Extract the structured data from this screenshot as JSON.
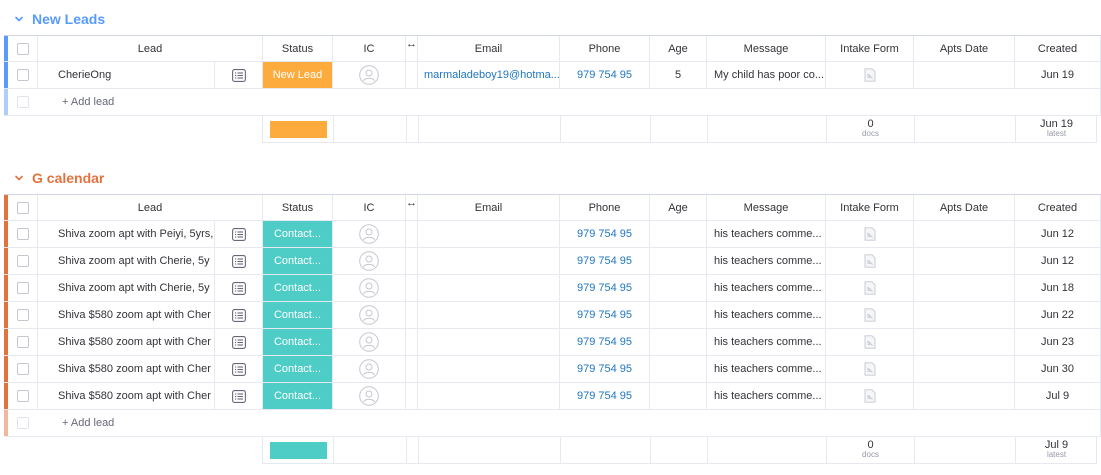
{
  "columns": {
    "lead": "Lead",
    "status": "Status",
    "ic": "IC",
    "resize": "↔",
    "email": "Email",
    "phone": "Phone",
    "age": "Age",
    "message": "Message",
    "intake_form": "Intake Form",
    "apts_date": "Apts Date",
    "created": "Created"
  },
  "colors": {
    "new_leads": "#579bfc",
    "g_calendar": "#e2733f",
    "new_lead_status": "#fdab3d",
    "contacted_status": "#4eccc6"
  },
  "groups": [
    {
      "title": "New Leads",
      "color": "#579bfc",
      "add_lead": "+ Add lead",
      "rows": [
        {
          "lead": "CherieOng",
          "status": "New Lead",
          "status_color": "#fdab3d",
          "email": "marmaladeboy19@hotma...",
          "phone": "979 754 95",
          "age": "5",
          "message": "My child has poor co...",
          "created": "Jun 19"
        }
      ],
      "summary": {
        "docs_count": "0",
        "docs_label": "docs",
        "created_latest": "Jun 19",
        "latest_label": "latest",
        "bar_color": "#fdab3d"
      }
    },
    {
      "title": "G calendar",
      "color": "#e2733f",
      "add_lead": "+ Add lead",
      "rows": [
        {
          "lead": "Shiva zoom apt with Peiyi, 5yrs,",
          "status": "Contact...",
          "status_color": "#4eccc6",
          "email": "",
          "phone": "979 754 95",
          "age": "",
          "message": "his teachers comme...",
          "created": "Jun 12"
        },
        {
          "lead": "Shiva zoom apt with Cherie, 5y",
          "status": "Contact...",
          "status_color": "#4eccc6",
          "email": "",
          "phone": "979 754 95",
          "age": "",
          "message": "his teachers comme...",
          "created": "Jun 12"
        },
        {
          "lead": "Shiva zoom apt with Cherie, 5y",
          "status": "Contact...",
          "status_color": "#4eccc6",
          "email": "",
          "phone": "979 754 95",
          "age": "",
          "message": "his teachers comme...",
          "created": "Jun 18"
        },
        {
          "lead": "Shiva $580 zoom apt with Cher",
          "status": "Contact...",
          "status_color": "#4eccc6",
          "email": "",
          "phone": "979 754 95",
          "age": "",
          "message": "his teachers comme...",
          "created": "Jun 22"
        },
        {
          "lead": "Shiva $580 zoom apt with Cher",
          "status": "Contact...",
          "status_color": "#4eccc6",
          "email": "",
          "phone": "979 754 95",
          "age": "",
          "message": "his teachers comme...",
          "created": "Jun 23"
        },
        {
          "lead": "Shiva $580 zoom apt with Cher",
          "status": "Contact...",
          "status_color": "#4eccc6",
          "email": "",
          "phone": "979 754 95",
          "age": "",
          "message": "his teachers comme...",
          "created": "Jun 30"
        },
        {
          "lead": "Shiva $580 zoom apt with Cher",
          "status": "Contact...",
          "status_color": "#4eccc6",
          "email": "",
          "phone": "979 754 95",
          "age": "",
          "message": "his teachers comme...",
          "created": "Jul 9"
        }
      ],
      "summary": {
        "docs_count": "0",
        "docs_label": "docs",
        "created_latest": "Jul 9",
        "latest_label": "latest",
        "bar_color": "#4eccc6"
      }
    }
  ]
}
